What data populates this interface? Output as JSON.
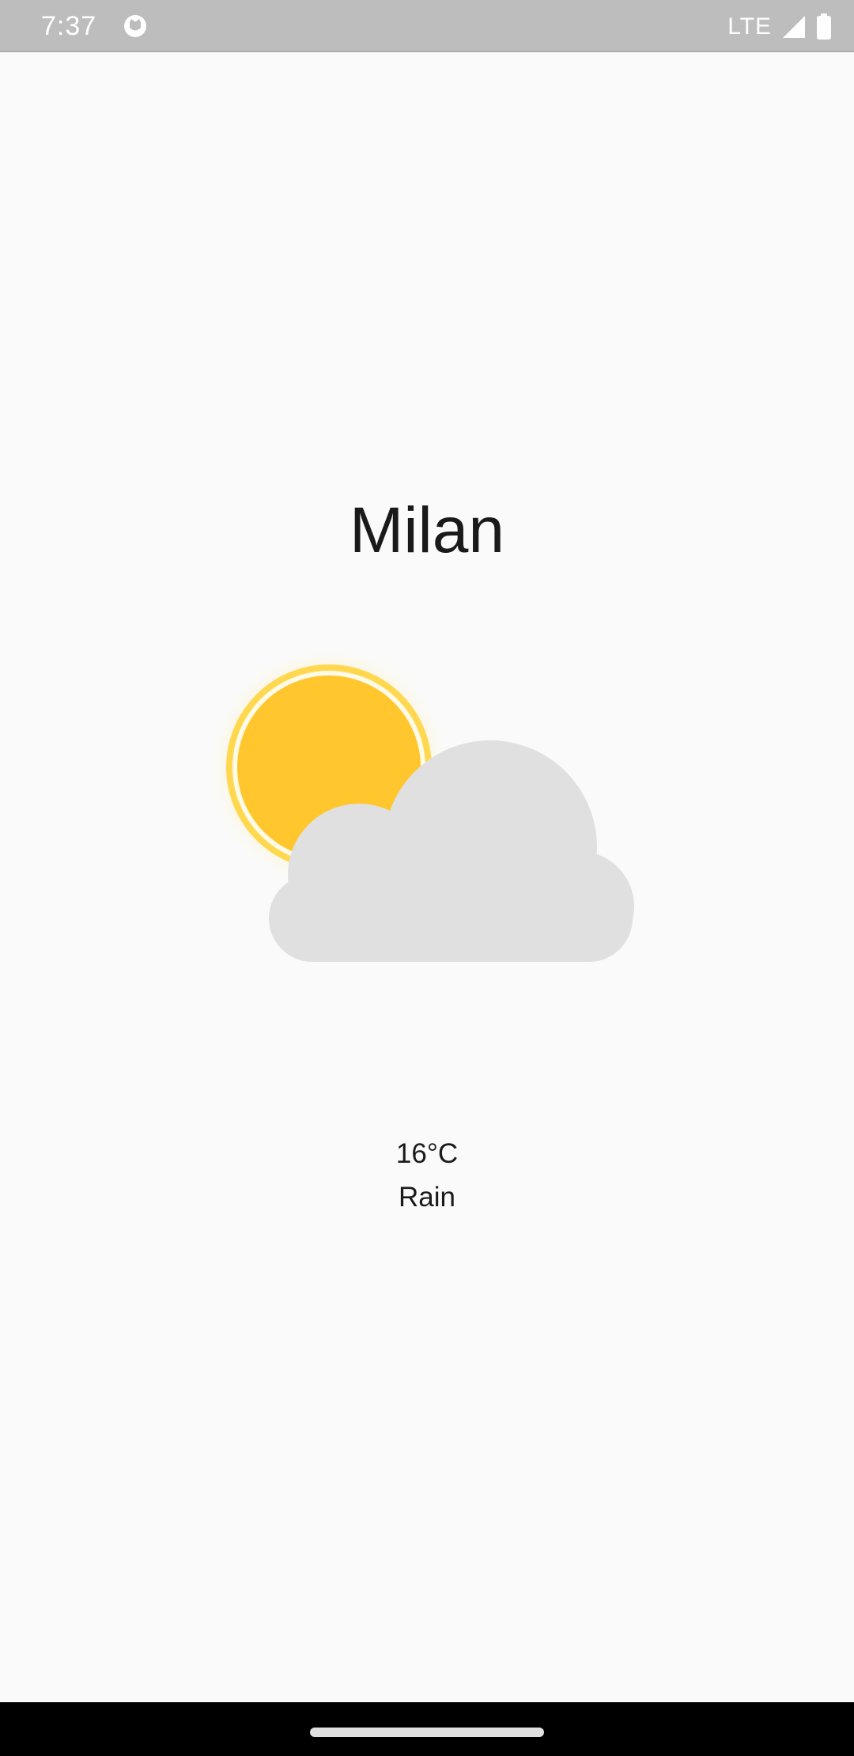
{
  "status_bar": {
    "time": "7:37",
    "network": "LTE",
    "icons": [
      "app-notification-icon",
      "signal-icon",
      "battery-icon"
    ]
  },
  "weather": {
    "city": "Milan",
    "temperature": "16°C",
    "condition": "Rain",
    "icon": "partly-cloudy-icon"
  },
  "colors": {
    "sun": "#ffc62e",
    "sun_ring": "#ffd84f",
    "cloud": "#e0e0e0",
    "background": "#fafafa",
    "status_bar": "#bdbdbd",
    "nav_bar": "#000000"
  }
}
